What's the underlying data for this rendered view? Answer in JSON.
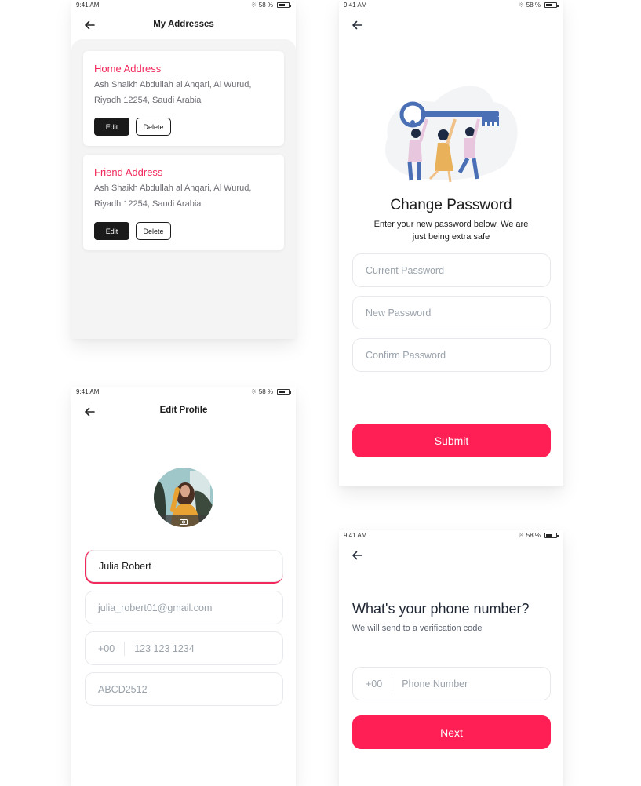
{
  "status_bar": {
    "time": "9:41 AM",
    "battery": "58 %",
    "battery_level": 0.58
  },
  "colors": {
    "accent": "#ff1f55",
    "title_pink": "#f2285c",
    "dark_button": "#1a1a1a",
    "placeholder": "#9aa2ab"
  },
  "addresses_screen": {
    "title": "My Addresses",
    "cards": [
      {
        "title": "Home Address",
        "line1": "Ash Shaikh Abdullah al Anqari, Al Wurud,",
        "line2": "Riyadh 12254, Saudi Arabia",
        "edit_label": "Edit",
        "delete_label": "Delete"
      },
      {
        "title": "Friend Address",
        "line1": "Ash Shaikh Abdullah al Anqari, Al Wurud,",
        "line2": "Riyadh 12254, Saudi Arabia",
        "edit_label": "Edit",
        "delete_label": "Delete"
      }
    ]
  },
  "change_password_screen": {
    "title": "Change Password",
    "subtitle_line1": "Enter  your new password below, We are",
    "subtitle_line2": "just being extra safe",
    "fields": {
      "current_placeholder": "Current Password",
      "new_placeholder": "New Password",
      "confirm_placeholder": "Confirm Password"
    },
    "submit_label": "Submit",
    "illustration": "people-holding-key-illustration"
  },
  "edit_profile_screen": {
    "title": "Edit Profile",
    "avatar_icon": "camera-icon",
    "name_value": "Julia Robert",
    "email_placeholder": "julia_robert01@gmail.com",
    "phone_prefix": "+00",
    "phone_placeholder": "123 123 1234",
    "code_placeholder": "ABCD2512"
  },
  "phone_screen": {
    "title": "What's your phone number?",
    "subtitle": "We will send to a verification  code",
    "phone_prefix": "+00",
    "phone_placeholder": "Phone Number",
    "next_label": "Next"
  }
}
